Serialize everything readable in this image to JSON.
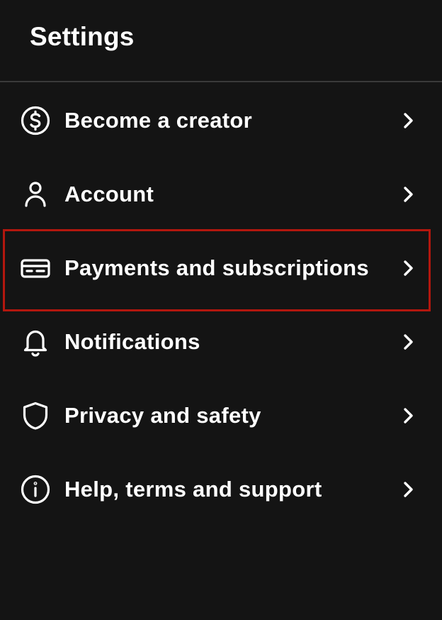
{
  "header": {
    "title": "Settings"
  },
  "menu": {
    "items": [
      {
        "label": "Become a creator",
        "icon": "dollar-circle-icon"
      },
      {
        "label": "Account",
        "icon": "user-icon"
      },
      {
        "label": "Payments and subscriptions",
        "icon": "credit-card-icon",
        "highlighted": true
      },
      {
        "label": "Notifications",
        "icon": "bell-icon"
      },
      {
        "label": "Privacy and safety",
        "icon": "shield-icon"
      },
      {
        "label": "Help, terms and support",
        "icon": "info-circle-icon"
      }
    ]
  },
  "colors": {
    "background": "#141414",
    "text": "#ffffff",
    "divider": "#3a3a3a",
    "highlight_border": "#b3170e"
  }
}
